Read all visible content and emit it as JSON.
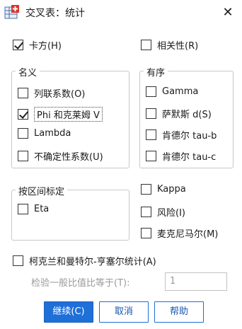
{
  "window": {
    "title": "交叉表：统计",
    "close_glyph": "✕"
  },
  "options": {
    "chisq": {
      "label": "卡方(H)",
      "checked": true
    },
    "correlations": {
      "label": "相关性(R)",
      "checked": false
    },
    "risk": {
      "label": "风险(I)",
      "checked": false
    },
    "kappa": {
      "label": "Kappa",
      "checked": false
    },
    "mcnemar": {
      "label": "麦克尼马尔(M)",
      "checked": false
    },
    "cmh": {
      "label": "柯克兰和曼特尔-亨塞尔统计(A)",
      "checked": false
    }
  },
  "nominal": {
    "legend": "名义",
    "items": [
      {
        "label": "列联系数(O)",
        "checked": false
      },
      {
        "label": "Phi 和克莱姆 V",
        "checked": true
      },
      {
        "label": "Lambda",
        "checked": false
      },
      {
        "label": "不确定性系数(U)",
        "checked": false
      }
    ]
  },
  "ordinal": {
    "legend": "有序",
    "items": [
      {
        "label": "Gamma",
        "checked": false
      },
      {
        "label": "萨默斯 d(S)",
        "checked": false
      },
      {
        "label": "肯德尔 tau-b",
        "checked": false
      },
      {
        "label": "肯德尔 tau-c",
        "checked": false
      }
    ]
  },
  "interval": {
    "legend": "按区间标定",
    "items": [
      {
        "label": "Eta",
        "checked": false
      }
    ]
  },
  "odds_test": {
    "label": "检验一般比值比等于(T):",
    "value": "1"
  },
  "buttons": {
    "continue": "继续(C)",
    "cancel": "取消",
    "help": "帮助"
  },
  "colors": {
    "primary": "#1f6fd9",
    "border": "#c8c8c8"
  }
}
